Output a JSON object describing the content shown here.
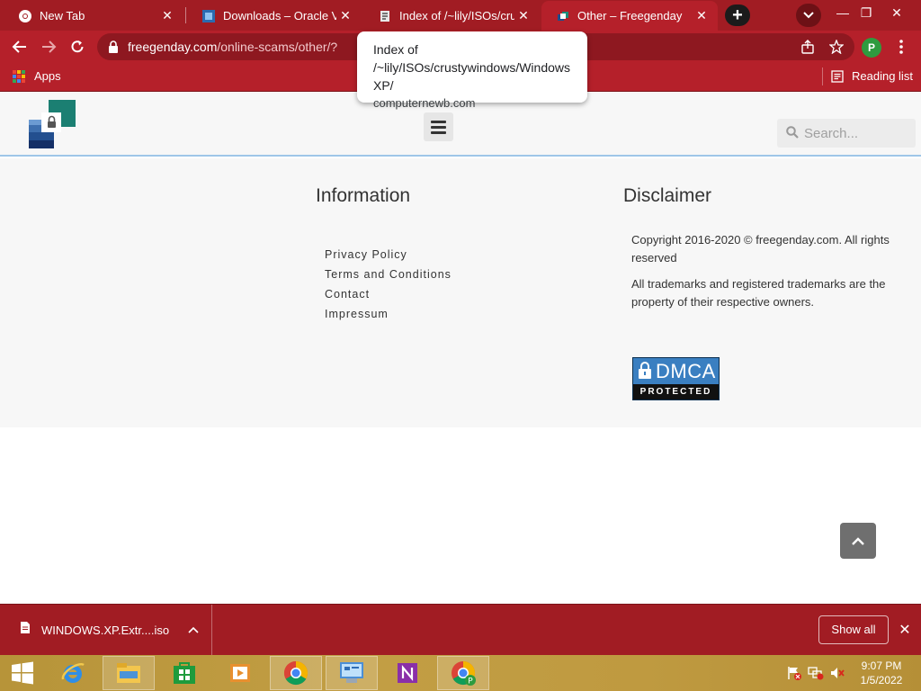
{
  "tabs": [
    {
      "title": "New Tab",
      "icon": "chrome-icon"
    },
    {
      "title": "Downloads – Oracle VM V",
      "icon": "virtualbox-icon"
    },
    {
      "title": "Index of /~lily/ISOs/crust",
      "icon": "directory-icon"
    },
    {
      "title": "Other – Freegenday",
      "icon": "freegenday-icon"
    }
  ],
  "omnibox": {
    "host": "freegenday.com",
    "path": "/online-scams/other/?"
  },
  "profile_initial": "P",
  "bookmarks": {
    "apps_label": "Apps",
    "reading_list_label": "Reading list"
  },
  "tooltip": {
    "title": "Index of /~lily/ISOs/crustywindows/Windows XP/",
    "domain": "computernewb.com"
  },
  "site": {
    "search_placeholder": "Search...",
    "information": {
      "heading": "Information",
      "links": [
        "Privacy Policy",
        "Terms and Conditions",
        "Contact",
        "Impressum"
      ]
    },
    "disclaimer": {
      "heading": "Disclaimer",
      "copyright": "Copyright 2016-2020 © freegenday.com. All rights reserved",
      "trademarks": "All trademarks and registered trademarks are the property of their respective owners."
    },
    "badge": {
      "word": "DMCA",
      "sub": "PROTECTED"
    }
  },
  "download_shelf": {
    "file_name": "WINDOWS.XP.Extr....iso",
    "show_all_label": "Show all"
  },
  "taskbar": {
    "time": "9:07 PM",
    "date": "1/5/2022"
  },
  "colors": {
    "chrome_accent": "#b5202a",
    "tabstrip": "#a11c23",
    "taskbar": "#c29e44"
  }
}
